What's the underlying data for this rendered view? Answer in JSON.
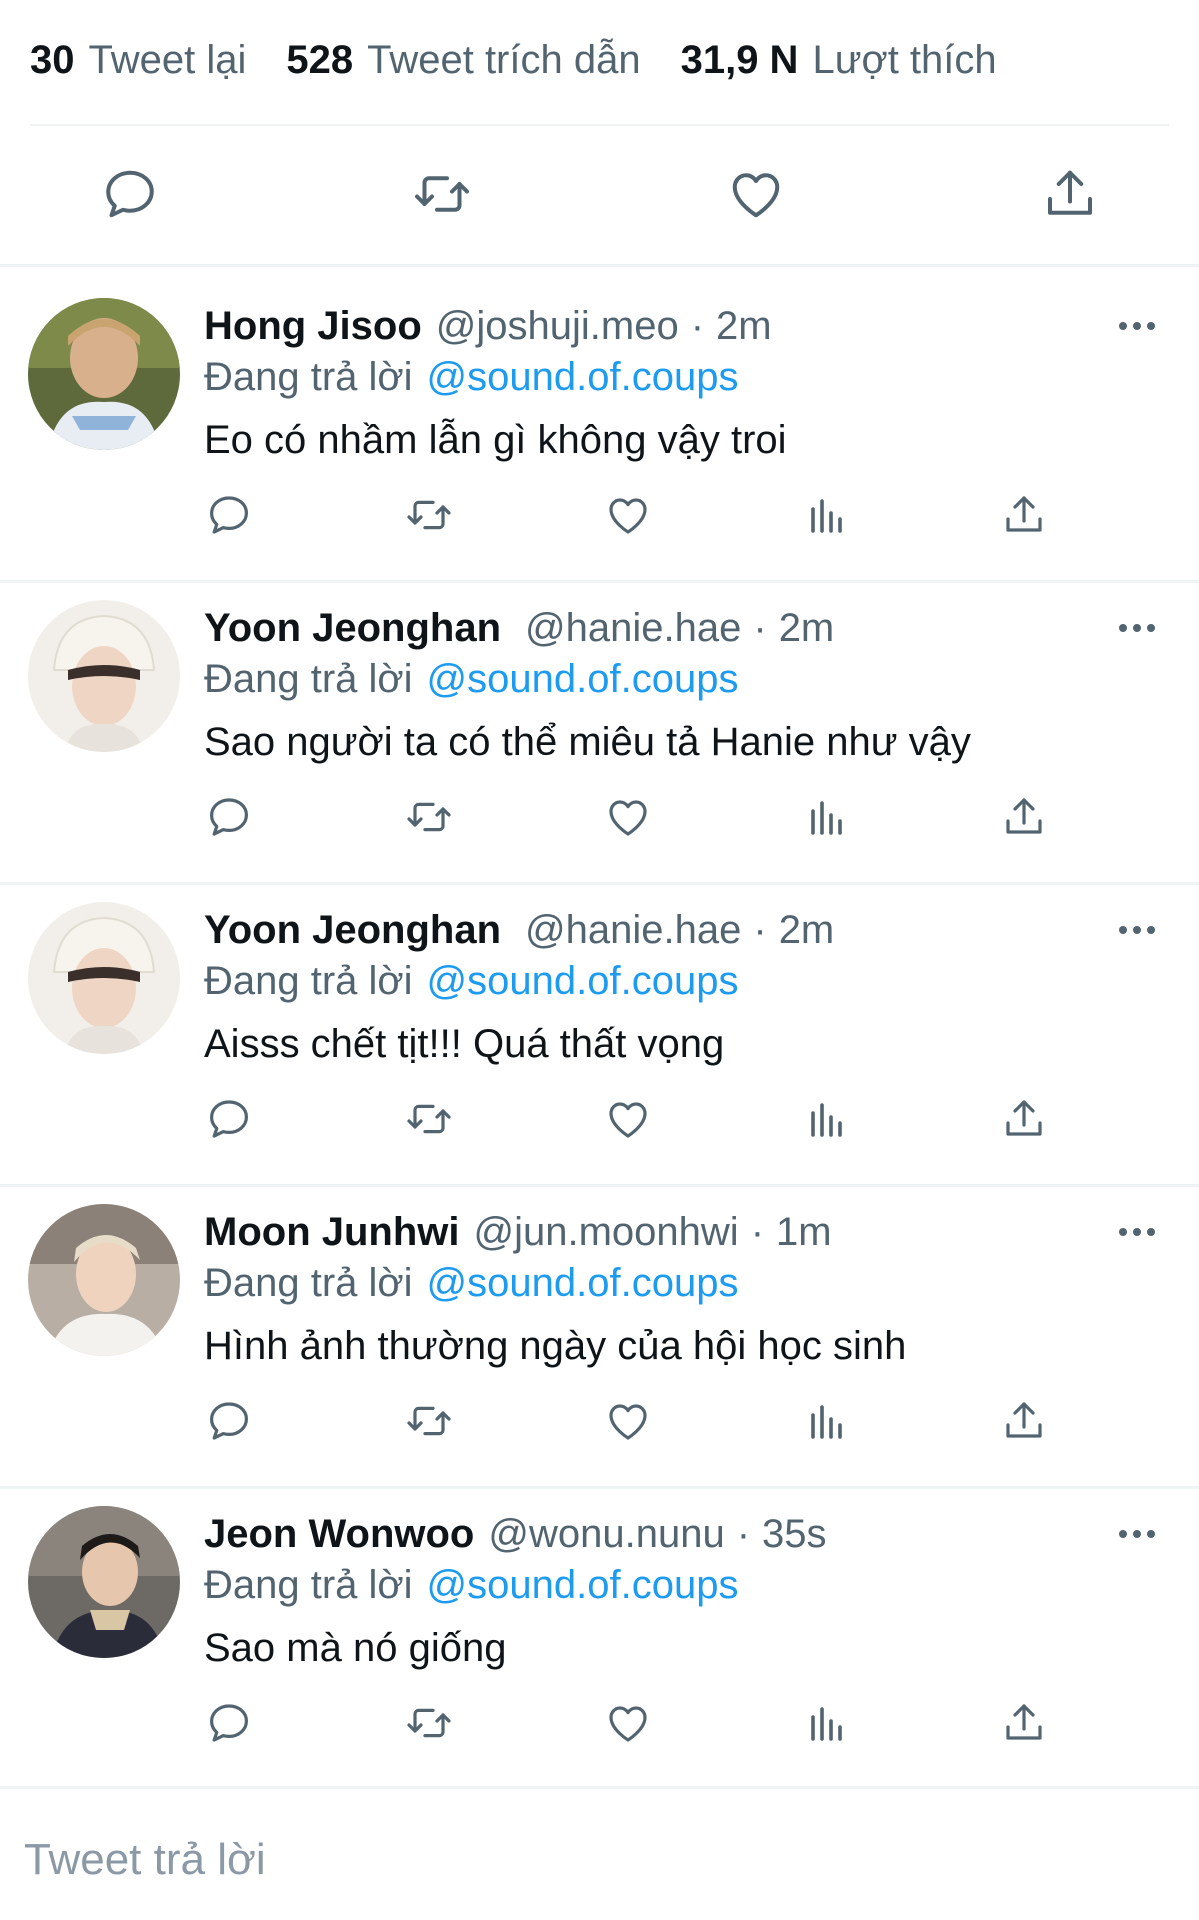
{
  "stats": {
    "retweets": {
      "count": "30",
      "label": "Tweet lại"
    },
    "quotes": {
      "count": "528",
      "label": "Tweet trích dẫn"
    },
    "likes": {
      "count": "31,9 N",
      "label": "Lượt thích"
    }
  },
  "main_actions": [
    {
      "icon": "reply-icon"
    },
    {
      "icon": "retweet-icon"
    },
    {
      "icon": "like-icon"
    },
    {
      "icon": "share-icon"
    }
  ],
  "replying_label": "Đang trả lời",
  "replies": [
    {
      "name": "Hong Jisoo",
      "handle": "@joshuji.meo",
      "sep": "·",
      "time": "2m",
      "mention": "@sound.of.coups",
      "text": "Eo có nhầm lẫn gì không vậy troi"
    },
    {
      "name": "Yoon Jeonghan",
      "handle": "@hanie.hae",
      "sep": "·",
      "time": "2m",
      "mention": "@sound.of.coups",
      "text": "Sao người ta có thể miêu tả Hanie như vậy"
    },
    {
      "name": "Yoon Jeonghan",
      "handle": "@hanie.hae",
      "sep": "·",
      "time": "2m",
      "mention": "@sound.of.coups",
      "text": "Aisss chết tịt!!! Quá thất vọng"
    },
    {
      "name": "Moon Junhwi",
      "handle": "@jun.moonhwi",
      "sep": "·",
      "time": "1m",
      "mention": "@sound.of.coups",
      "text": "Hình ảnh thường ngày của hội học sinh"
    },
    {
      "name": "Jeon Wonwoo",
      "handle": "@wonu.nunu",
      "sep": "·",
      "time": "35s",
      "mention": "@sound.of.coups",
      "text": "Sao mà nó giống"
    }
  ],
  "compose": {
    "placeholder": "Tweet trả lời"
  },
  "colors": {
    "accent": "#1d9bf0",
    "secondary_text": "#536471",
    "icon": "#536471",
    "divider": "#eff3f4"
  }
}
